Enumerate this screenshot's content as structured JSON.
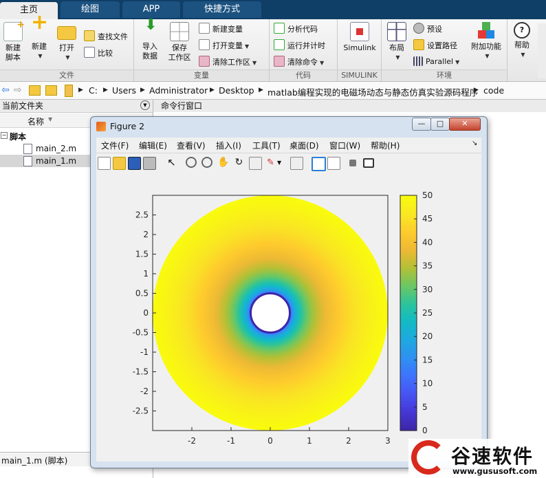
{
  "tabs": [
    {
      "label": "主页"
    },
    {
      "label": "绘图"
    },
    {
      "label": "APP"
    },
    {
      "label": "快捷方式"
    }
  ],
  "ribbon": {
    "file": {
      "section_label": "文件",
      "new_script": "新建\n脚本",
      "new": "新建",
      "open": "打开",
      "find_files": "查找文件",
      "compare": "比较"
    },
    "variable": {
      "section_label": "变量",
      "import": "导入\n数据",
      "save": "保存\n工作区",
      "new_var": "新建变量",
      "open_var": "打开变量",
      "clear_ws": "清除工作区"
    },
    "code": {
      "section_label": "代码",
      "analyze": "分析代码",
      "run_time": "运行并计时",
      "clear_cmd": "清除命令"
    },
    "simulink": {
      "section_label": "SIMULINK",
      "label": "Simulink"
    },
    "env": {
      "section_label": "环境",
      "layout": "布局",
      "prefs": "预设",
      "set_path": "设置路径",
      "parallel": "Parallel",
      "addons": "附加功能"
    },
    "help": "帮助"
  },
  "address": {
    "crumbs": [
      "C:",
      "Users",
      "Administrator",
      "Desktop",
      "matlab编程实现的电磁场动态与静态仿真实验源码程序",
      "code"
    ]
  },
  "left_panel": {
    "title": "当前文件夹",
    "col_name": "名称",
    "folder": "脚本",
    "files": [
      "main_2.m",
      "main_1.m"
    ],
    "status": "main_1.m  (脚本)"
  },
  "right_panel": {
    "title": "命令行窗口"
  },
  "figure": {
    "title": "Figure 2",
    "menu": [
      "文件(F)",
      "编辑(E)",
      "查看(V)",
      "插入(I)",
      "工具(T)",
      "桌面(D)",
      "窗口(W)",
      "帮助(H)"
    ],
    "min_btn": "—",
    "max_btn": "□",
    "close_btn": "✕"
  },
  "chart_data": {
    "type": "heatmap",
    "description_kind": "filled annulus contour plot",
    "inner_radius": 0.5,
    "outer_radius": 3,
    "value_inner": 0,
    "value_outer": 50,
    "xlim": [
      -3,
      3
    ],
    "ylim": [
      -3,
      3
    ],
    "xticks": [
      "-2",
      "-1",
      "0",
      "1",
      "2",
      "3"
    ],
    "yticks": [
      "2.5",
      "2",
      "1.5",
      "1",
      "0.5",
      "0",
      "-0.5",
      "-1",
      "-1.5",
      "-2",
      "-2.5"
    ],
    "colorbar_range": [
      0,
      50
    ],
    "colorbar_ticks": [
      "50",
      "45",
      "40",
      "35",
      "30",
      "25",
      "20",
      "15",
      "10",
      "5",
      "0"
    ],
    "colormap": [
      "#3e26a8",
      "#4538d7",
      "#4755f3",
      "#3e74fd",
      "#2e91f1",
      "#1fa8e0",
      "#12bac6",
      "#2bc49c",
      "#6bc763",
      "#b2c036",
      "#edb935",
      "#feca2d",
      "#f9e722",
      "#f9fb0e"
    ],
    "grid": false
  },
  "watermark": {
    "brand": "谷速软件",
    "url": "www.gususoft.com"
  }
}
